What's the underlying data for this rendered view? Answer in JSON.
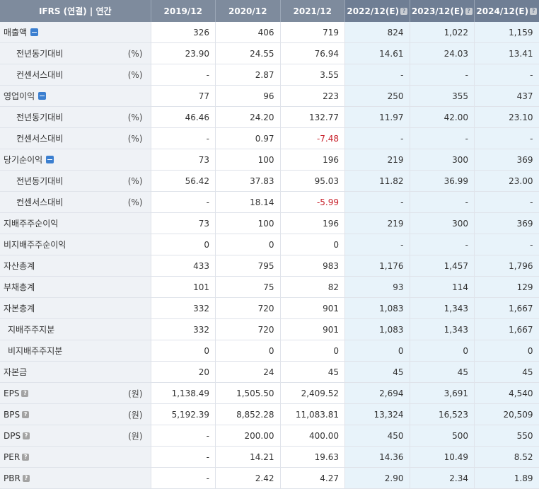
{
  "header": {
    "title": "IFRS (연결) | 연간",
    "periods": [
      "2019/12",
      "2020/12",
      "2021/12",
      "2022/12(E)",
      "2023/12(E)",
      "2024/12(E)"
    ],
    "estimate_help_glyph": "?"
  },
  "colors": {
    "estimate_bg": "#e8f3fa",
    "label_bg": "#eff2f6",
    "header_bg": "#7e8b9d",
    "negative": "#c8202a"
  },
  "rows": [
    {
      "label": "매출액",
      "level": 0,
      "toggle": "minus-icon",
      "unit": "",
      "help": false,
      "values": [
        "326",
        "406",
        "719",
        "824",
        "1,022",
        "1,159"
      ]
    },
    {
      "label": "전년동기대비",
      "level": 1,
      "unit": "(%)",
      "help": false,
      "values": [
        "23.90",
        "24.55",
        "76.94",
        "14.61",
        "24.03",
        "13.41"
      ]
    },
    {
      "label": "컨센서스대비",
      "level": 1,
      "unit": "(%)",
      "help": false,
      "values": [
        "-",
        "2.87",
        "3.55",
        "-",
        "-",
        "-"
      ]
    },
    {
      "label": "영업이익",
      "level": 0,
      "toggle": "minus-icon",
      "unit": "",
      "help": false,
      "values": [
        "77",
        "96",
        "223",
        "250",
        "355",
        "437"
      ]
    },
    {
      "label": "전년동기대비",
      "level": 1,
      "unit": "(%)",
      "help": false,
      "values": [
        "46.46",
        "24.20",
        "132.77",
        "11.97",
        "42.00",
        "23.10"
      ]
    },
    {
      "label": "컨센서스대비",
      "level": 1,
      "unit": "(%)",
      "help": false,
      "values": [
        "-",
        "0.97",
        "-7.48",
        "-",
        "-",
        "-"
      ]
    },
    {
      "label": "당기순이익",
      "level": 0,
      "toggle": "minus-icon",
      "unit": "",
      "help": false,
      "values": [
        "73",
        "100",
        "196",
        "219",
        "300",
        "369"
      ]
    },
    {
      "label": "전년동기대비",
      "level": 1,
      "unit": "(%)",
      "help": false,
      "values": [
        "56.42",
        "37.83",
        "95.03",
        "11.82",
        "36.99",
        "23.00"
      ]
    },
    {
      "label": "컨센서스대비",
      "level": 1,
      "unit": "(%)",
      "help": false,
      "values": [
        "-",
        "18.14",
        "-5.99",
        "-",
        "-",
        "-"
      ]
    },
    {
      "label": "지배주주순이익",
      "level": 0,
      "unit": "",
      "help": false,
      "values": [
        "73",
        "100",
        "196",
        "219",
        "300",
        "369"
      ]
    },
    {
      "label": "비지배주주순이익",
      "level": 0,
      "unit": "",
      "help": false,
      "values": [
        "0",
        "0",
        "0",
        "-",
        "-",
        "-"
      ]
    },
    {
      "label": "자산총계",
      "level": 0,
      "unit": "",
      "help": false,
      "values": [
        "433",
        "795",
        "983",
        "1,176",
        "1,457",
        "1,796"
      ]
    },
    {
      "label": "부채총계",
      "level": 0,
      "unit": "",
      "help": false,
      "values": [
        "101",
        "75",
        "82",
        "93",
        "114",
        "129"
      ]
    },
    {
      "label": "자본총계",
      "level": 0,
      "unit": "",
      "help": false,
      "values": [
        "332",
        "720",
        "901",
        "1,083",
        "1,343",
        "1,667"
      ]
    },
    {
      "label": "지배주주지분",
      "level": 2,
      "unit": "",
      "help": false,
      "values": [
        "332",
        "720",
        "901",
        "1,083",
        "1,343",
        "1,667"
      ]
    },
    {
      "label": "비지배주주지분",
      "level": 2,
      "unit": "",
      "help": false,
      "values": [
        "0",
        "0",
        "0",
        "0",
        "0",
        "0"
      ]
    },
    {
      "label": "자본금",
      "level": 0,
      "unit": "",
      "help": false,
      "values": [
        "20",
        "24",
        "45",
        "45",
        "45",
        "45"
      ]
    },
    {
      "label": "EPS",
      "level": 0,
      "unit": "(원)",
      "help": true,
      "values": [
        "1,138.49",
        "1,505.50",
        "2,409.52",
        "2,694",
        "3,691",
        "4,540"
      ]
    },
    {
      "label": "BPS",
      "level": 0,
      "unit": "(원)",
      "help": true,
      "values": [
        "5,192.39",
        "8,852.28",
        "11,083.81",
        "13,324",
        "16,523",
        "20,509"
      ]
    },
    {
      "label": "DPS",
      "level": 0,
      "unit": "(원)",
      "help": true,
      "values": [
        "-",
        "200.00",
        "400.00",
        "450",
        "500",
        "550"
      ]
    },
    {
      "label": "PER",
      "level": 0,
      "unit": "",
      "help": true,
      "values": [
        "-",
        "14.21",
        "19.63",
        "14.36",
        "10.49",
        "8.52"
      ]
    },
    {
      "label": "PBR",
      "level": 0,
      "unit": "",
      "help": true,
      "values": [
        "-",
        "2.42",
        "4.27",
        "2.90",
        "2.34",
        "1.89"
      ]
    }
  ]
}
